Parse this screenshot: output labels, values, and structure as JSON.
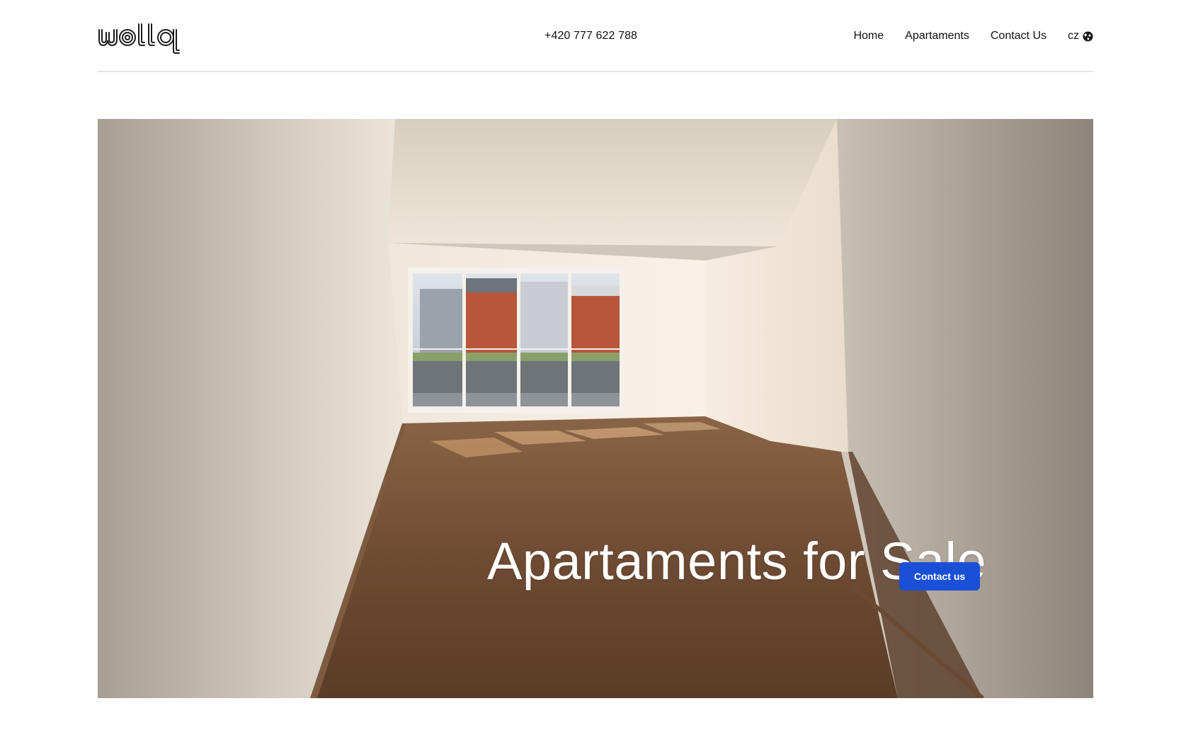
{
  "brand": {
    "logo_text": "wolla",
    "logo_icon": "wolla-logo"
  },
  "header": {
    "phone": "+420 777 622 788",
    "nav": [
      {
        "label": "Home"
      },
      {
        "label": "Apartaments"
      },
      {
        "label": "Contact Us"
      }
    ],
    "language": {
      "label": "cz",
      "icon": "globe-icon"
    }
  },
  "hero": {
    "title": "Apartaments for Sale",
    "cta_label": "Contact us",
    "image": "empty apartment interior"
  },
  "colors": {
    "accent": "#1a4fd8",
    "divider": "#e3e3e3",
    "text": "#111111"
  }
}
